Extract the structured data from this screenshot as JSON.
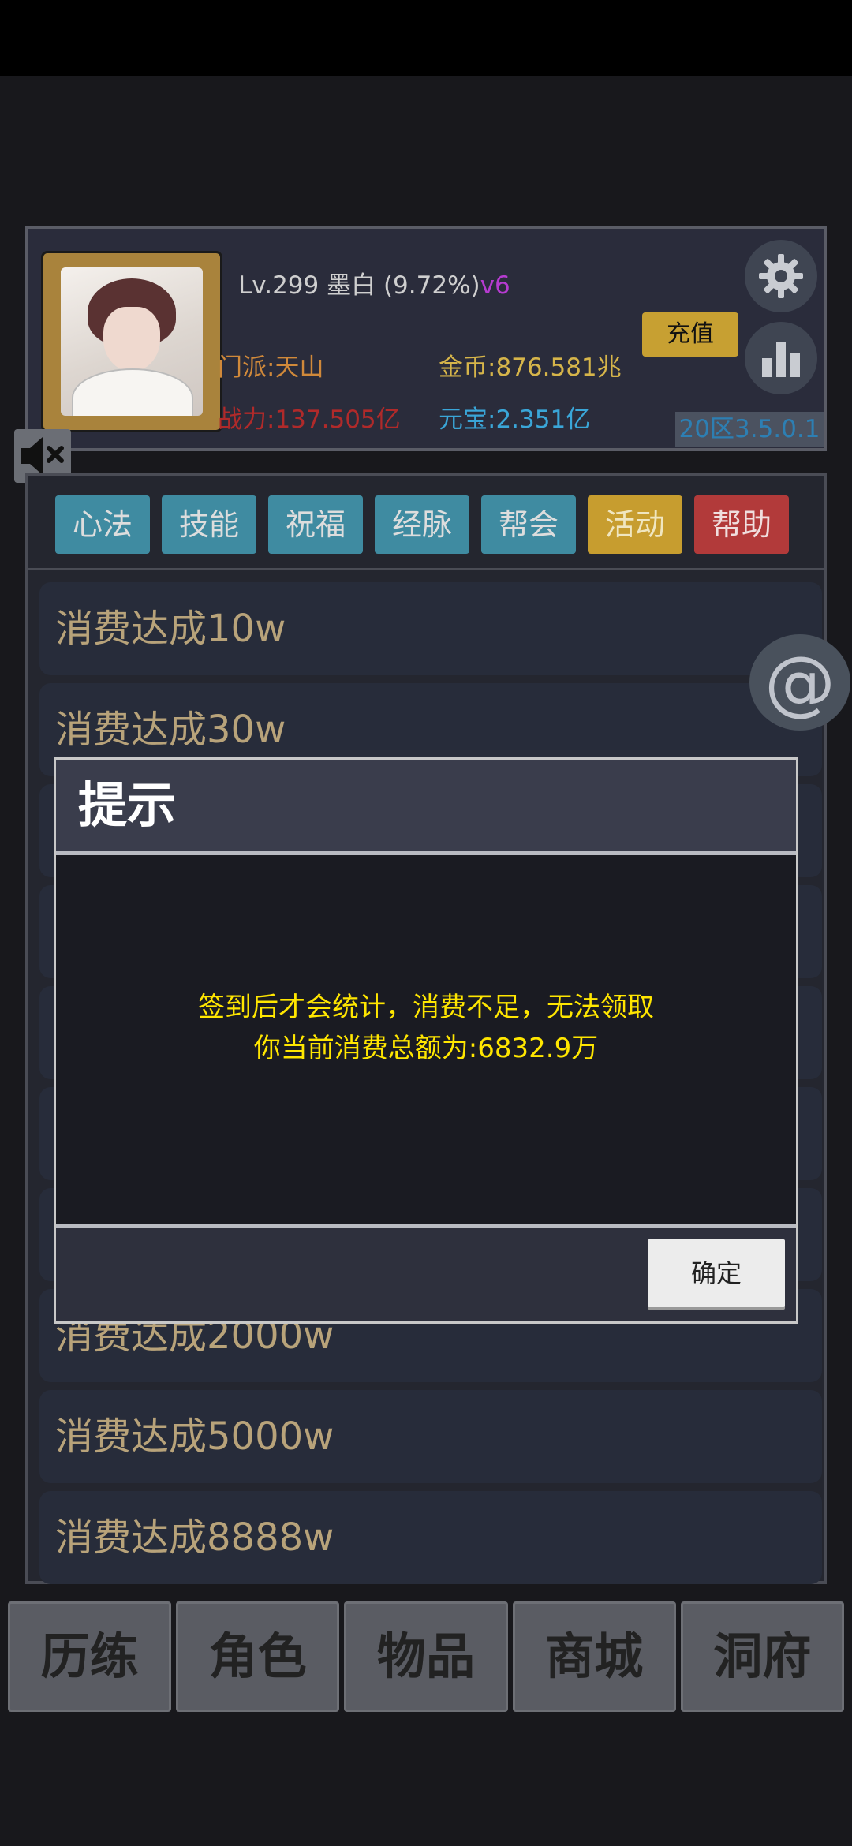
{
  "header": {
    "level": "Lv.299",
    "name": "墨白",
    "percent": "(9.72%)",
    "vip": "v6",
    "sect": "门派:天山",
    "power": "战力:137.505亿",
    "gold": "金币:876.581兆",
    "ingot": "元宝:2.351亿",
    "recharge_label": "充值",
    "version": "20区3.5.0.1"
  },
  "tabs": [
    {
      "label": "心法"
    },
    {
      "label": "技能"
    },
    {
      "label": "祝福"
    },
    {
      "label": "经脉"
    },
    {
      "label": "帮会"
    },
    {
      "label": "活动"
    },
    {
      "label": "帮助"
    }
  ],
  "list": {
    "items": [
      {
        "label": "消费达成10w"
      },
      {
        "label": "消费达成30w"
      },
      {
        "label": ""
      },
      {
        "label": ""
      },
      {
        "label": ""
      },
      {
        "label": ""
      },
      {
        "label": ""
      },
      {
        "label": "消费达成2000w"
      },
      {
        "label": "消费达成5000w"
      },
      {
        "label": "消费达成8888w"
      }
    ]
  },
  "dialog": {
    "title": "提示",
    "line1": "签到后才会统计，消费不足，无法领取",
    "line2": "你当前消费总额为:6832.9万",
    "ok_label": "确定"
  },
  "at_symbol": "@",
  "bottom_nav": [
    {
      "label": "历练"
    },
    {
      "label": "角色"
    },
    {
      "label": "物品"
    },
    {
      "label": "商城"
    },
    {
      "label": "洞府"
    }
  ]
}
